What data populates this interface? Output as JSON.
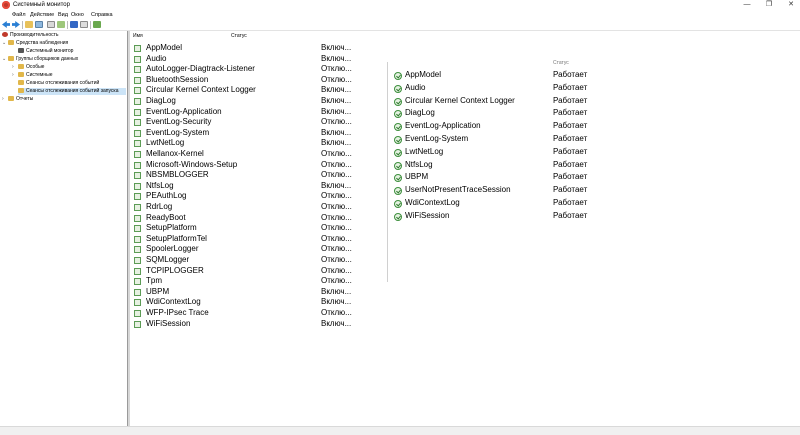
{
  "window": {
    "title": "Системный монитор",
    "minimize_glyph": "—",
    "maximize_glyph": "❐",
    "close_glyph": "✕"
  },
  "menu": [
    "Файл",
    "Действие",
    "Вид",
    "Окно",
    "Справка"
  ],
  "toolbar": {
    "icons": [
      "back-arrow-icon",
      "forward-arrow-icon",
      "folder-up-icon",
      "console-tree-icon",
      "properties-icon",
      "export-icon",
      "refresh-icon",
      "help-icon",
      "new-icon",
      "monitor-icon"
    ]
  },
  "tree": {
    "items": [
      {
        "label": "Производительность",
        "level": 0,
        "expanded": true,
        "icon": "performance-icon"
      },
      {
        "label": "Средства наблюдения",
        "level": 1,
        "expanded": true,
        "icon": "monitoring-tools-icon"
      },
      {
        "label": "Системный монитор",
        "level": 2,
        "expanded": false,
        "icon": "system-monitor-icon"
      },
      {
        "label": "Группы сборщиков данных",
        "level": 1,
        "expanded": true,
        "icon": "collector-sets-icon"
      },
      {
        "label": "Особые",
        "level": 2,
        "expanded": false,
        "icon": "folder-icon"
      },
      {
        "label": "Системные",
        "level": 2,
        "expanded": false,
        "icon": "folder-icon"
      },
      {
        "label": "Сеансы отслеживания событий",
        "level": 2,
        "expanded": false,
        "icon": "folder-icon"
      },
      {
        "label": "Сеансы отслеживания событий запуска",
        "level": 2,
        "expanded": false,
        "icon": "folder-icon",
        "selected": true
      },
      {
        "label": "Отчеты",
        "level": 1,
        "expanded": false,
        "icon": "reports-icon"
      }
    ]
  },
  "middle": {
    "col_name": "Имя",
    "col_status": "Статус",
    "rows": [
      {
        "name": "AppModel",
        "status": "Включ..."
      },
      {
        "name": "Audio",
        "status": "Включ..."
      },
      {
        "name": "AutoLogger-Diagtrack-Listener",
        "status": "Отклю..."
      },
      {
        "name": "BluetoothSession",
        "status": "Отклю..."
      },
      {
        "name": "Circular Kernel Context Logger",
        "status": "Включ..."
      },
      {
        "name": "DiagLog",
        "status": "Включ..."
      },
      {
        "name": "EventLog-Application",
        "status": "Включ..."
      },
      {
        "name": "EventLog-Security",
        "status": "Отклю..."
      },
      {
        "name": "EventLog-System",
        "status": "Включ..."
      },
      {
        "name": "LwtNetLog",
        "status": "Включ..."
      },
      {
        "name": "Mellanox-Kernel",
        "status": "Отклю..."
      },
      {
        "name": "Microsoft-Windows-Setup",
        "status": "Отклю..."
      },
      {
        "name": "NBSMBLOGGER",
        "status": "Отклю..."
      },
      {
        "name": "NtfsLog",
        "status": "Включ..."
      },
      {
        "name": "PEAuthLog",
        "status": "Отклю..."
      },
      {
        "name": "RdrLog",
        "status": "Отклю..."
      },
      {
        "name": "ReadyBoot",
        "status": "Отклю..."
      },
      {
        "name": "SetupPlatform",
        "status": "Отклю..."
      },
      {
        "name": "SetupPlatformTel",
        "status": "Отклю..."
      },
      {
        "name": "SpoolerLogger",
        "status": "Отклю..."
      },
      {
        "name": "SQMLogger",
        "status": "Отклю..."
      },
      {
        "name": "TCPIPLOGGER",
        "status": "Отклю..."
      },
      {
        "name": "Tpm",
        "status": "Отклю..."
      },
      {
        "name": "UBPM",
        "status": "Включ..."
      },
      {
        "name": "WdiContextLog",
        "status": "Включ..."
      },
      {
        "name": "WFP-IPsec Trace",
        "status": "Отклю..."
      },
      {
        "name": "WiFiSession",
        "status": "Включ..."
      }
    ]
  },
  "right": {
    "col_status_partial": "Статус",
    "rows": [
      {
        "name": "AppModel",
        "status": "Работает"
      },
      {
        "name": "Audio",
        "status": "Работает"
      },
      {
        "name": "Circular Kernel Context Logger",
        "status": "Работает"
      },
      {
        "name": "DiagLog",
        "status": "Работает"
      },
      {
        "name": "EventLog-Application",
        "status": "Работает"
      },
      {
        "name": "EventLog-System",
        "status": "Работает"
      },
      {
        "name": "LwtNetLog",
        "status": "Работает"
      },
      {
        "name": "NtfsLog",
        "status": "Работает"
      },
      {
        "name": "UBPM",
        "status": "Работает"
      },
      {
        "name": "UserNotPresentTraceSession",
        "status": "Работает"
      },
      {
        "name": "WdiContextLog",
        "status": "Работает"
      },
      {
        "name": "WiFiSession",
        "status": "Работает"
      }
    ]
  },
  "colors": {
    "selection": "#cce4f7",
    "status_icon_green": "#3d8f3d"
  }
}
